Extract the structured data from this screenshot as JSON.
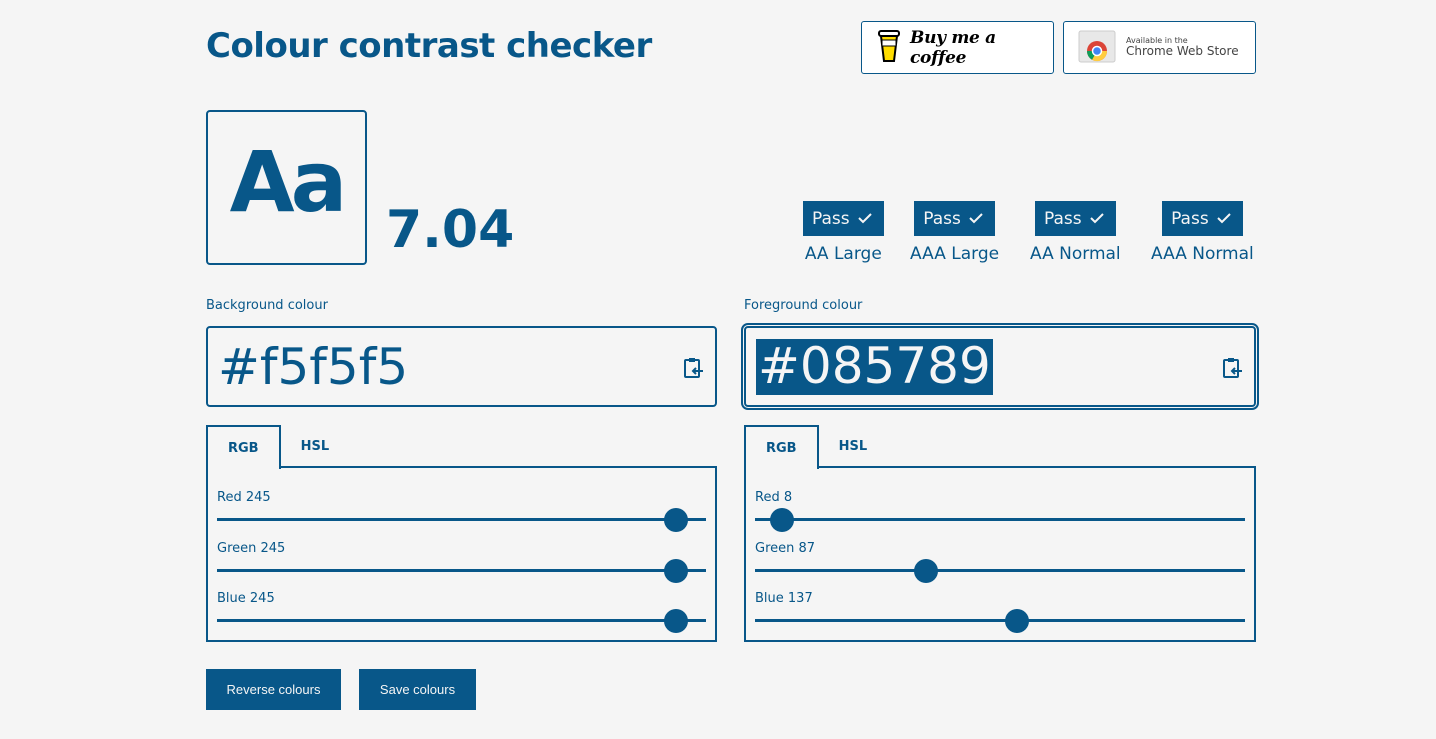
{
  "title": "Colour contrast checker",
  "header": {
    "coffee_label": "Buy me a coffee",
    "chrome_small": "Available in the",
    "chrome_big": "Chrome Web Store"
  },
  "preview": {
    "sample_text": "Aa"
  },
  "ratio": "7.04",
  "results": [
    {
      "status": "Pass",
      "label": "AA Large"
    },
    {
      "status": "Pass",
      "label": "AAA Large"
    },
    {
      "status": "Pass",
      "label": "AA Normal"
    },
    {
      "status": "Pass",
      "label": "AAA Normal"
    }
  ],
  "background": {
    "label": "Background colour",
    "hex": "#f5f5f5",
    "tabs": [
      "RGB",
      "HSL"
    ],
    "active_tab": "RGB",
    "sliders": [
      {
        "label": "Red 245",
        "value": 245,
        "max": 255
      },
      {
        "label": "Green 245",
        "value": 245,
        "max": 255
      },
      {
        "label": "Blue 245",
        "value": 245,
        "max": 255
      }
    ]
  },
  "foreground": {
    "label": "Foreground colour",
    "hex": "#085789",
    "tabs": [
      "RGB",
      "HSL"
    ],
    "active_tab": "RGB",
    "sliders": [
      {
        "label": "Red 8",
        "value": 8,
        "max": 255
      },
      {
        "label": "Green 87",
        "value": 87,
        "max": 255
      },
      {
        "label": "Blue 137",
        "value": 137,
        "max": 255
      }
    ]
  },
  "actions": {
    "reverse": "Reverse colours",
    "save": "Save colours"
  },
  "colors": {
    "primary": "#085789",
    "background": "#f5f5f5"
  }
}
